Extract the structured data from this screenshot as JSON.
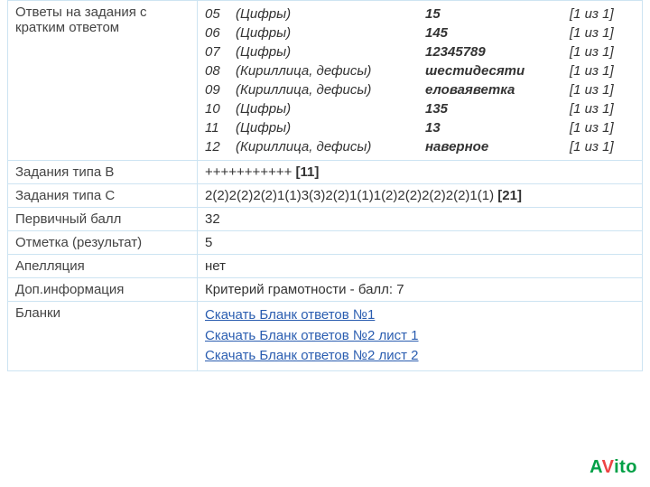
{
  "labels": {
    "short_answers": "Ответы на задания с кратким ответом",
    "type_b": "Задания типа В",
    "type_c": "Задания типа С",
    "primary_score": "Первичный балл",
    "mark": "Отметка (результат)",
    "appeal": "Апелляция",
    "extra": "Доп.информация",
    "blanks": "Бланки"
  },
  "answers": [
    {
      "num": "05",
      "type": "(Цифры)",
      "value": "15",
      "score": "[1 из 1]"
    },
    {
      "num": "06",
      "type": "(Цифры)",
      "value": "145",
      "score": "[1 из 1]"
    },
    {
      "num": "07",
      "type": "(Цифры)",
      "value": "12345789",
      "score": "[1 из 1]"
    },
    {
      "num": "08",
      "type": "(Кириллица, дефисы)",
      "value": "шестидесяти",
      "score": "[1 из 1]"
    },
    {
      "num": "09",
      "type": "(Кириллица, дефисы)",
      "value": "еловаяветка",
      "score": "[1 из 1]"
    },
    {
      "num": "10",
      "type": "(Цифры)",
      "value": "135",
      "score": "[1 из 1]"
    },
    {
      "num": "11",
      "type": "(Цифры)",
      "value": "13",
      "score": "[1 из 1]"
    },
    {
      "num": "12",
      "type": "(Кириллица, дефисы)",
      "value": "наверное",
      "score": "[1 из 1]"
    }
  ],
  "type_b": {
    "marks": "+++++++++++ ",
    "total": "[11]"
  },
  "type_c": {
    "marks": "2(2)2(2)2(2)1(1)3(3)2(2)1(1)1(2)2(2)2(2)2(2)1(1) ",
    "total": "[21]"
  },
  "primary_score": "32",
  "mark": "5",
  "appeal": "нет",
  "extra": "Критерий грамотности - балл: 7",
  "blank_links": [
    "Скачать Бланк ответов №1",
    "Скачать Бланк ответов №2 лист 1",
    "Скачать Бланк ответов №2 лист 2"
  ],
  "watermark": {
    "a": "A",
    "v": "V",
    "ito": "ito"
  }
}
